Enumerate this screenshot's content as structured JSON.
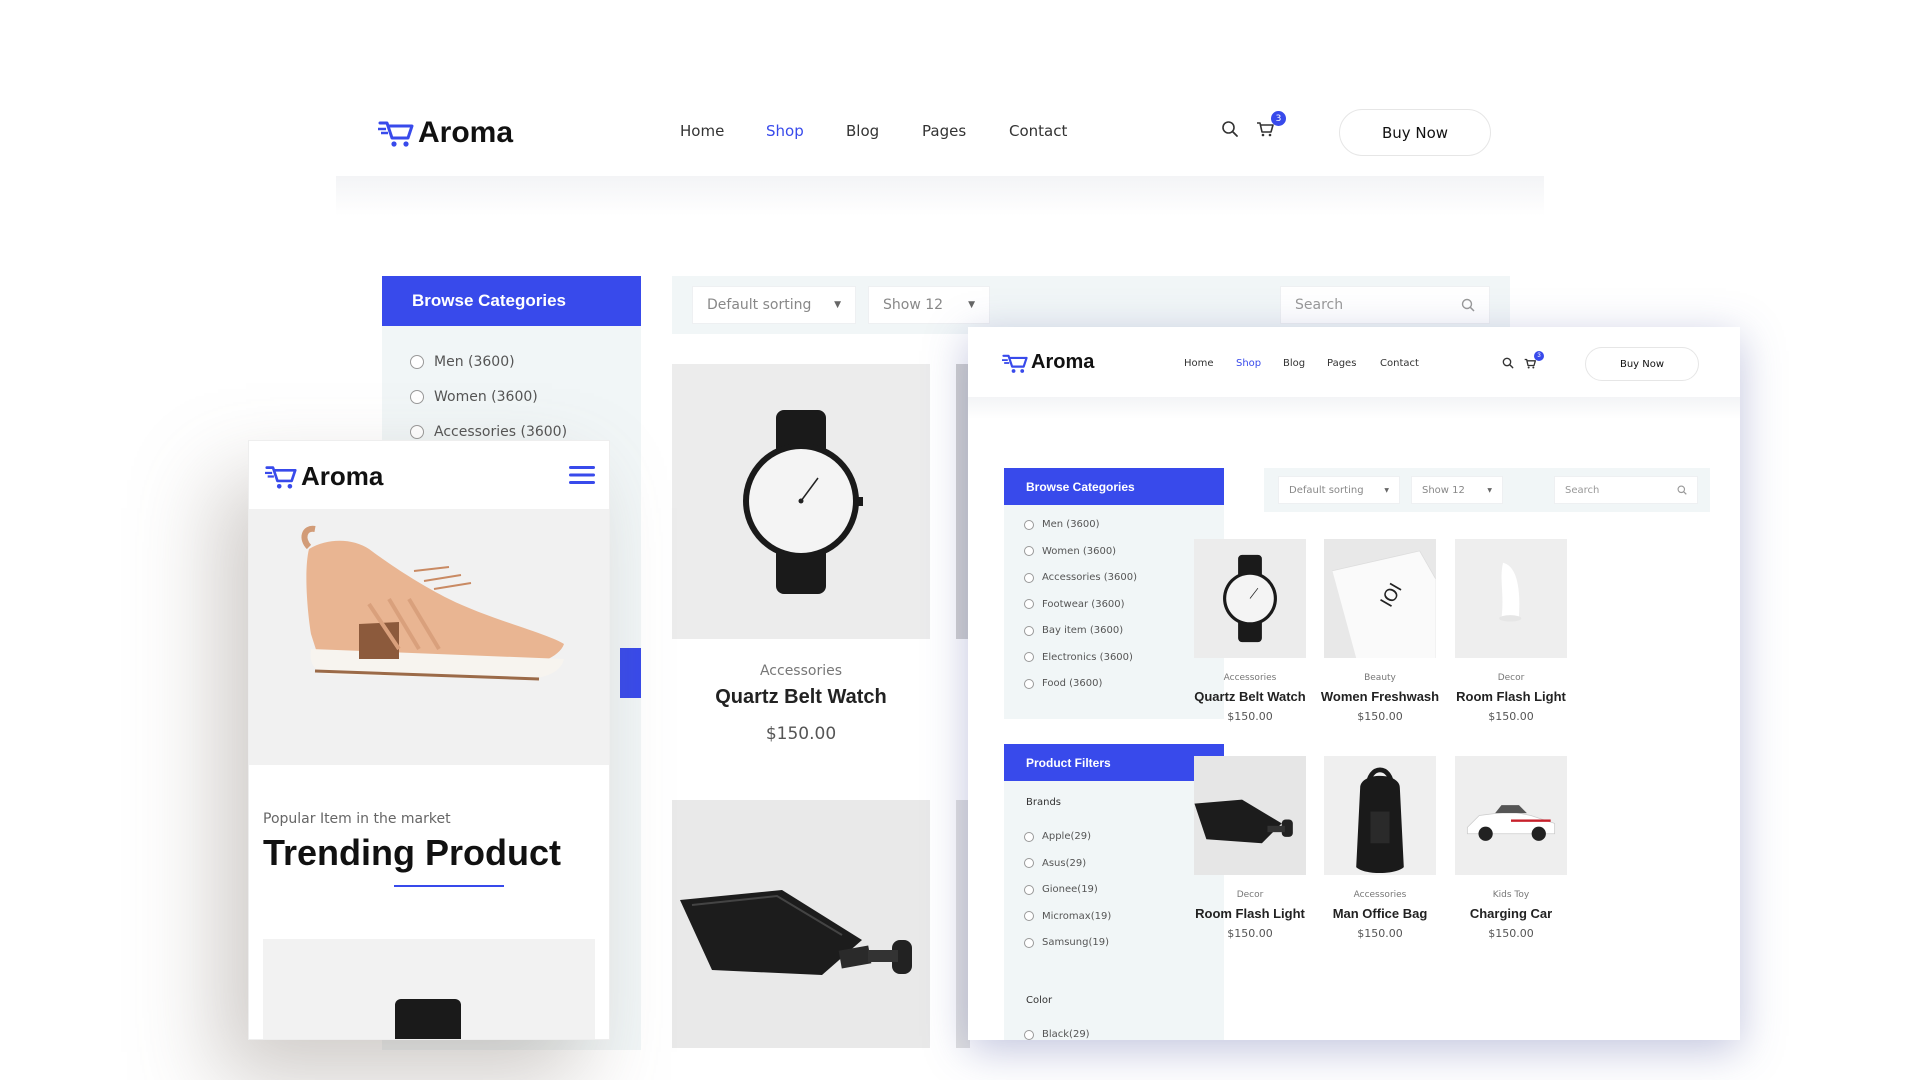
{
  "brand": {
    "name": "Aroma",
    "accent": "#384aeb",
    "panel_bg": "#f1f6f7"
  },
  "nav": {
    "items": [
      "Home",
      "Shop",
      "Blog",
      "Pages",
      "Contact"
    ],
    "active": "Shop",
    "cart_count": "3",
    "buy_now": "Buy Now"
  },
  "sidebar": {
    "browse_title": "Browse Categories",
    "categories": [
      "Men (3600)",
      "Women (3600)",
      "Accessories (3600)",
      "Footwear (3600)",
      "Bay item (3600)",
      "Electronics (3600)",
      "Food (3600)"
    ],
    "filters_title": "Product Filters",
    "brands_label": "Brands",
    "brands": [
      "Apple(29)",
      "Asus(29)",
      "Gionee(19)",
      "Micromax(19)",
      "Samsung(19)"
    ],
    "color_label": "Color",
    "colors": [
      "Black(29)"
    ]
  },
  "toolbar": {
    "sorting": "Default sorting",
    "show": "Show 12",
    "search_placeholder": "Search"
  },
  "products": [
    {
      "category": "Accessories",
      "name": "Quartz Belt Watch",
      "price": "$150.00",
      "icon": "watch"
    },
    {
      "category": "Beauty",
      "name": "Women Freshwash",
      "price": "$150.00",
      "icon": "tube"
    },
    {
      "category": "Decor",
      "name": "Room Flash Light",
      "price": "$150.00",
      "icon": "lamp"
    },
    {
      "category": "Decor",
      "name": "Room Flash Light",
      "price": "$150.00",
      "icon": "flask"
    },
    {
      "category": "Accessories",
      "name": "Man Office Bag",
      "price": "$150.00",
      "icon": "backpack"
    },
    {
      "category": "Kids Toy",
      "name": "Charging Car",
      "price": "$150.00",
      "icon": "car"
    }
  ],
  "mobile": {
    "subtitle": "Popular Item in the market",
    "title": "Trending Product",
    "hero_icon": "sneaker"
  }
}
